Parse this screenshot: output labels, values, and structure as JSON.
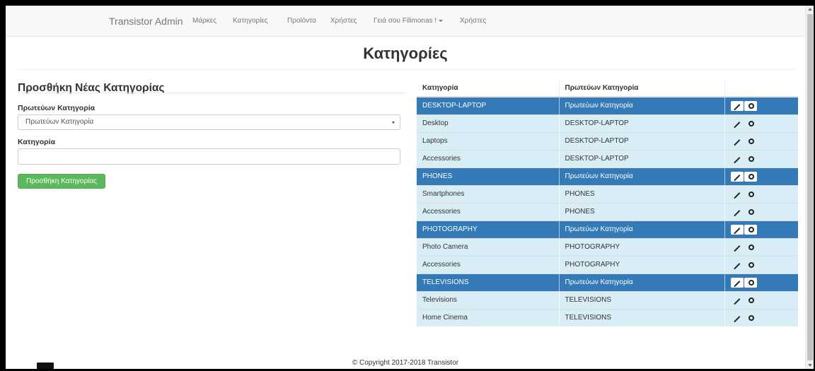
{
  "navbar": {
    "brand": "Transistor Admin",
    "links": [
      "Μάρκες",
      "Κατηγορίες",
      "Προϊόντα",
      "Χρήστες"
    ],
    "user_menu": "Γειά σου Filimonas !",
    "last_link": "Χρήστες"
  },
  "page": {
    "title": "Κατηγορίες"
  },
  "form": {
    "title": "Προσθήκη Νέας Κατηγορίας",
    "parent_label": "Πρωτεύων Κατηγορία",
    "parent_selected": "Πρωτεύων Κατηγορία",
    "category_label": "Κατηγορία",
    "category_value": "",
    "submit_label": "Προσθήκη Κατηγορίας"
  },
  "table": {
    "headers": [
      "Κατηγορία",
      "Πρωτεύων Κατηγορία",
      ""
    ],
    "rows": [
      {
        "name": "DESKTOP-LAPTOP",
        "parent": "Πρωτεύων Κατηγορία",
        "type": "parent"
      },
      {
        "name": "Desktop",
        "parent": "DESKTOP-LAPTOP",
        "type": "child"
      },
      {
        "name": "Laptops",
        "parent": "DESKTOP-LAPTOP",
        "type": "child"
      },
      {
        "name": "Accessories",
        "parent": "DESKTOP-LAPTOP",
        "type": "child"
      },
      {
        "name": "PHONES",
        "parent": "Πρωτεύων Κατηγορία",
        "type": "parent"
      },
      {
        "name": "Smartphones",
        "parent": "PHONES",
        "type": "child"
      },
      {
        "name": "Accessories",
        "parent": "PHONES",
        "type": "child"
      },
      {
        "name": "PHOTOGRAPHY",
        "parent": "Πρωτεύων Κατηγορία",
        "type": "parent"
      },
      {
        "name": "Photo Camera",
        "parent": "PHOTOGRAPHY",
        "type": "child"
      },
      {
        "name": "Accessories",
        "parent": "PHOTOGRAPHY",
        "type": "child"
      },
      {
        "name": "TELEVISIONS",
        "parent": "Πρωτεύων Κατηγορία",
        "type": "parent"
      },
      {
        "name": "Televisions",
        "parent": "TELEVISIONS",
        "type": "child"
      },
      {
        "name": "Home Cinema",
        "parent": "TELEVISIONS",
        "type": "child"
      }
    ],
    "row_actions": [
      "pencil-icon",
      "circle-icon"
    ]
  },
  "footer": {
    "copyright": "© Copyright 2017-2018 Transistor"
  },
  "colors": {
    "parent_row": "#337ab7",
    "child_row": "#d9edf7",
    "success_button": "#5cb85c"
  }
}
